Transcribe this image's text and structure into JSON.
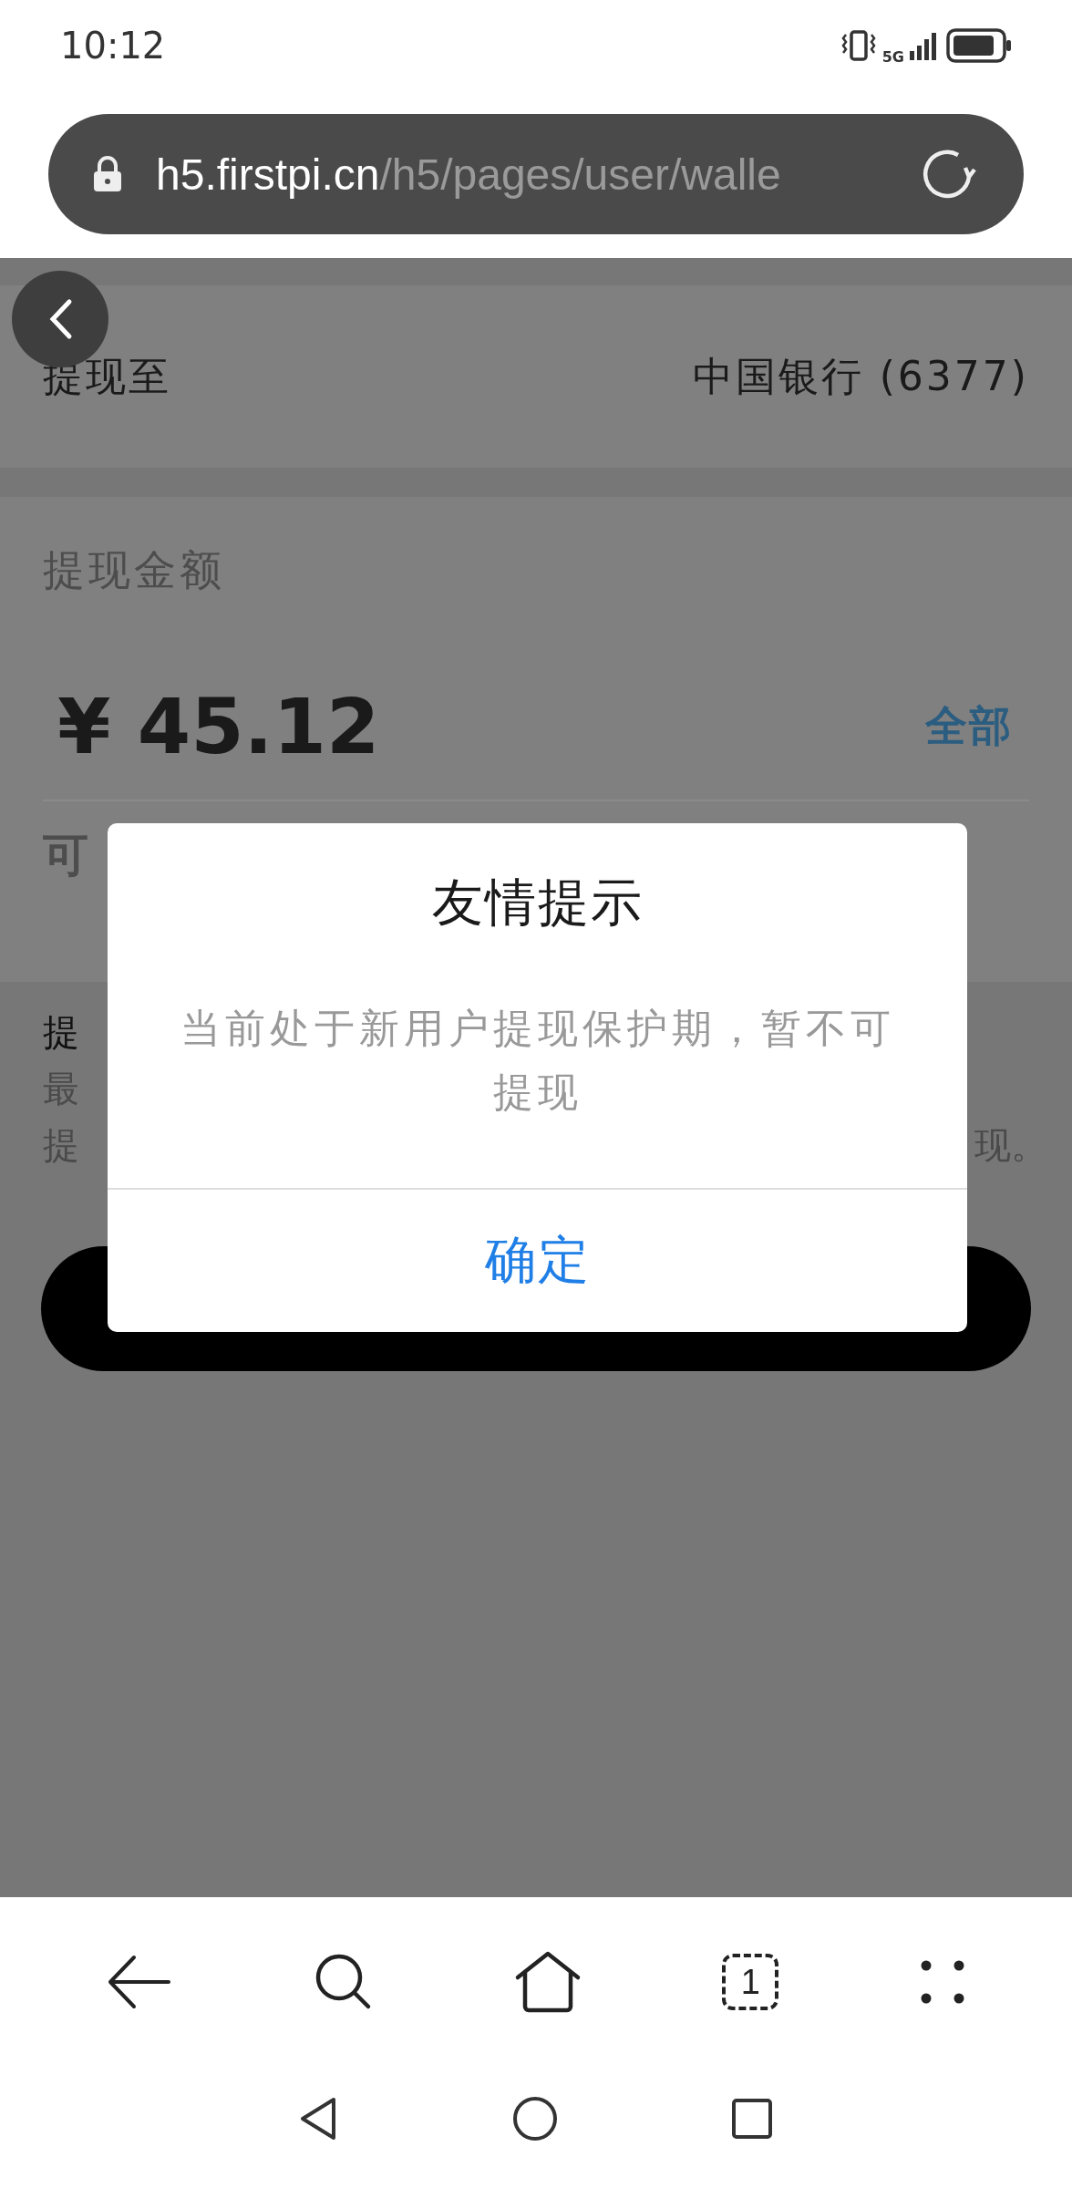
{
  "status_bar": {
    "time": "10:12",
    "network": "5G"
  },
  "address_bar": {
    "domain": "h5.firstpi.cn",
    "path": "/h5/pages/user/walle"
  },
  "withdraw_to": {
    "label": "提现至",
    "account": "中国银行 (6377)"
  },
  "amount": {
    "label": "提现金额",
    "value": "¥ 45.12",
    "all_link": "全部"
  },
  "available": {
    "label": "可"
  },
  "tips": [
    {
      "left": "提"
    },
    {
      "left": "最"
    },
    {
      "left": "提",
      "right": "现。"
    }
  ],
  "dialog": {
    "title": "友情提示",
    "message": "当前处于新用户提现保护期，暂不可提现",
    "confirm": "确定"
  },
  "toolbar": {
    "tab_count": "1"
  }
}
